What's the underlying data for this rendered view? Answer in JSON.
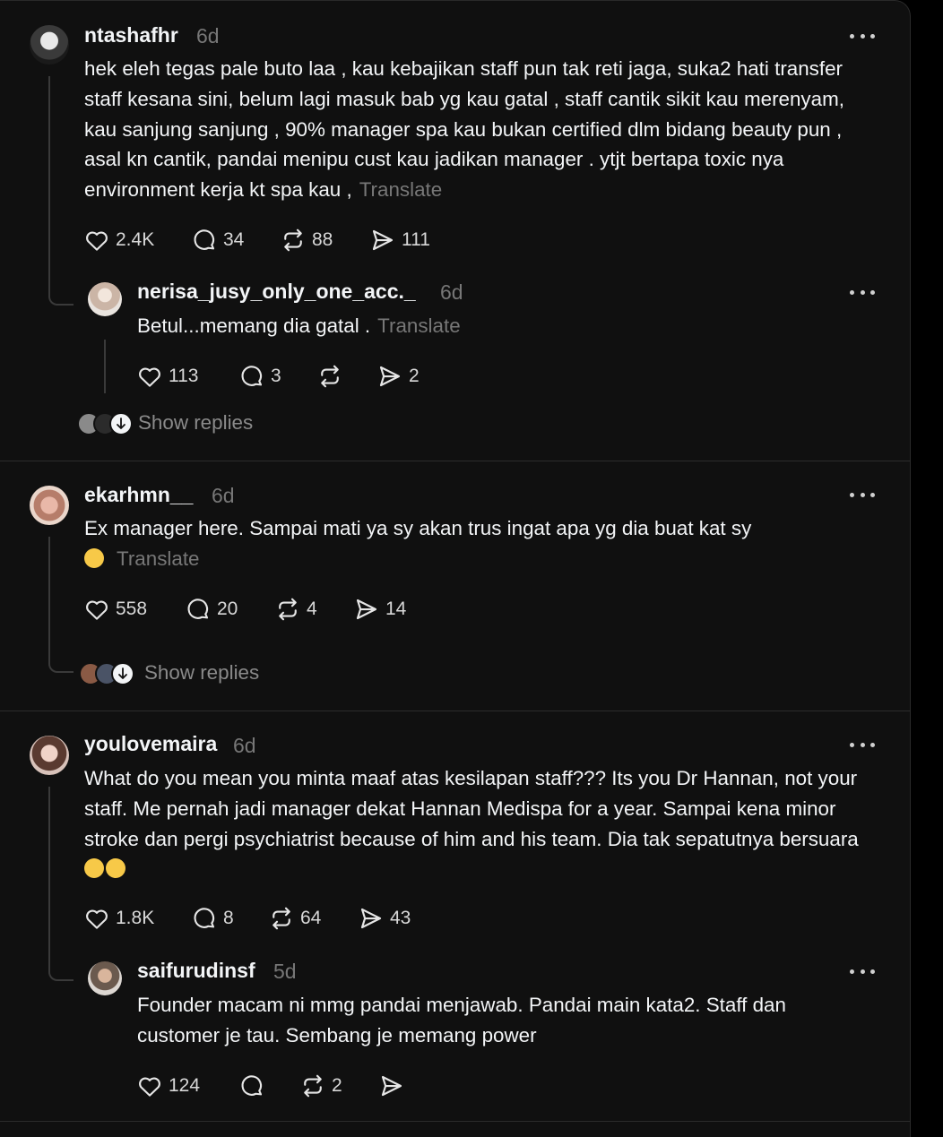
{
  "posts": [
    {
      "username": "ntashafhr",
      "time": "6d",
      "text": "hek eleh tegas pale buto laa , kau kebajikan staff pun tak reti jaga, suka2 hati transfer staff kesana sini, belum lagi masuk bab yg kau gatal , staff cantik sikit kau merenyam, kau sanjung sanjung , 90% manager spa kau bukan certified dlm bidang beauty pun , asal kn cantik, pandai menipu cust kau jadikan manager . ytjt bertapa toxic nya environment kerja kt spa kau ,",
      "translate": "Translate",
      "likes": "2.4K",
      "comments": "34",
      "reposts": "88",
      "shares": "111"
    },
    {
      "username": "nerisa_jusy_only_one_acc._",
      "time": "6d",
      "text": "Betul...memang dia gatal .",
      "translate": "Translate",
      "likes": "113",
      "comments": "3",
      "reposts": "",
      "shares": "2"
    },
    {
      "username": "ekarhmn__",
      "time": "6d",
      "text": "Ex manager here. Sampai mati ya sy akan trus ingat apa yg dia buat kat sy",
      "translate": "Translate",
      "likes": "558",
      "comments": "20",
      "reposts": "4",
      "shares": "14"
    },
    {
      "username": "youlovemaira",
      "time": "6d",
      "text": "What do you mean you minta maaf atas kesilapan staff??? Its you Dr Hannan, not your staff. Me pernah jadi manager dekat Hannan Medispa for a year. Sampai kena minor stroke dan pergi psychiatrist because of him and his team. Dia tak sepatutnya bersuara",
      "likes": "1.8K",
      "comments": "8",
      "reposts": "64",
      "shares": "43"
    },
    {
      "username": "saifurudinsf",
      "time": "5d",
      "text": "Founder macam ni mmg pandai menjawab. Pandai main kata2. Staff dan customer je tau. Sembang je memang power",
      "likes": "124",
      "comments": "",
      "reposts": "2",
      "shares": ""
    }
  ],
  "show_replies": [
    "Show replies",
    "Show replies"
  ],
  "icons": [
    "more-icon",
    "heart-icon",
    "comment-icon",
    "repost-icon",
    "share-icon",
    "arrow-down-icon"
  ],
  "colors": {
    "background": "#101010",
    "text": "#f3f5f7",
    "muted": "#777777"
  }
}
